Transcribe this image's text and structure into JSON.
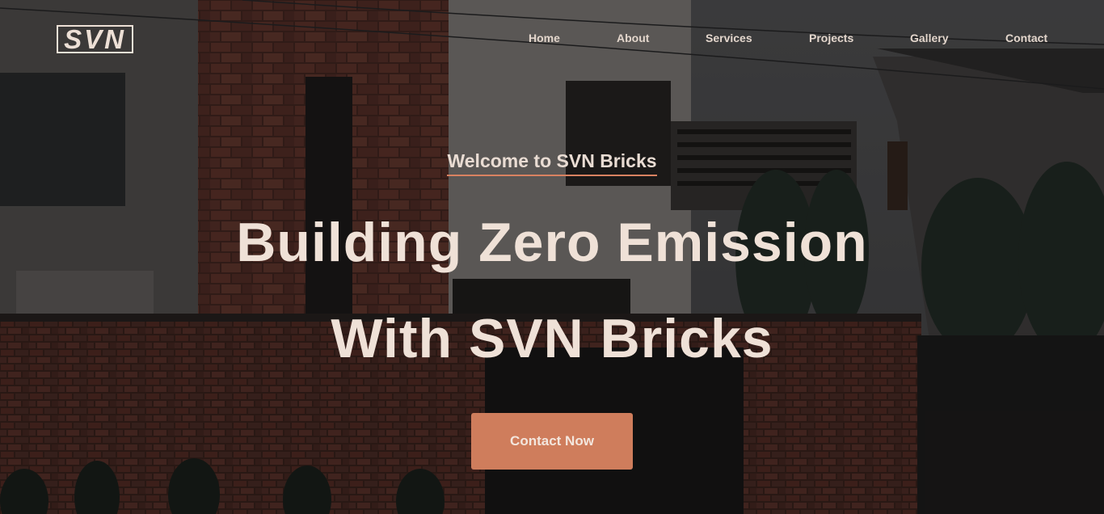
{
  "brand": {
    "logo_text": "SVN"
  },
  "nav": {
    "items": [
      {
        "label": "Home"
      },
      {
        "label": "About"
      },
      {
        "label": "Services"
      },
      {
        "label": "Projects"
      },
      {
        "label": "Gallery"
      },
      {
        "label": "Contact"
      }
    ]
  },
  "hero": {
    "eyebrow": "Welcome to SVN Bricks",
    "headline_line1": "Building Zero Emission",
    "headline_line2": "With SVN Bricks",
    "cta_label": "Contact Now",
    "background_image": "brick-house-photo"
  },
  "colors": {
    "accent": "#cf7d5c",
    "text": "#efe1d7",
    "underline": "#d98261"
  }
}
